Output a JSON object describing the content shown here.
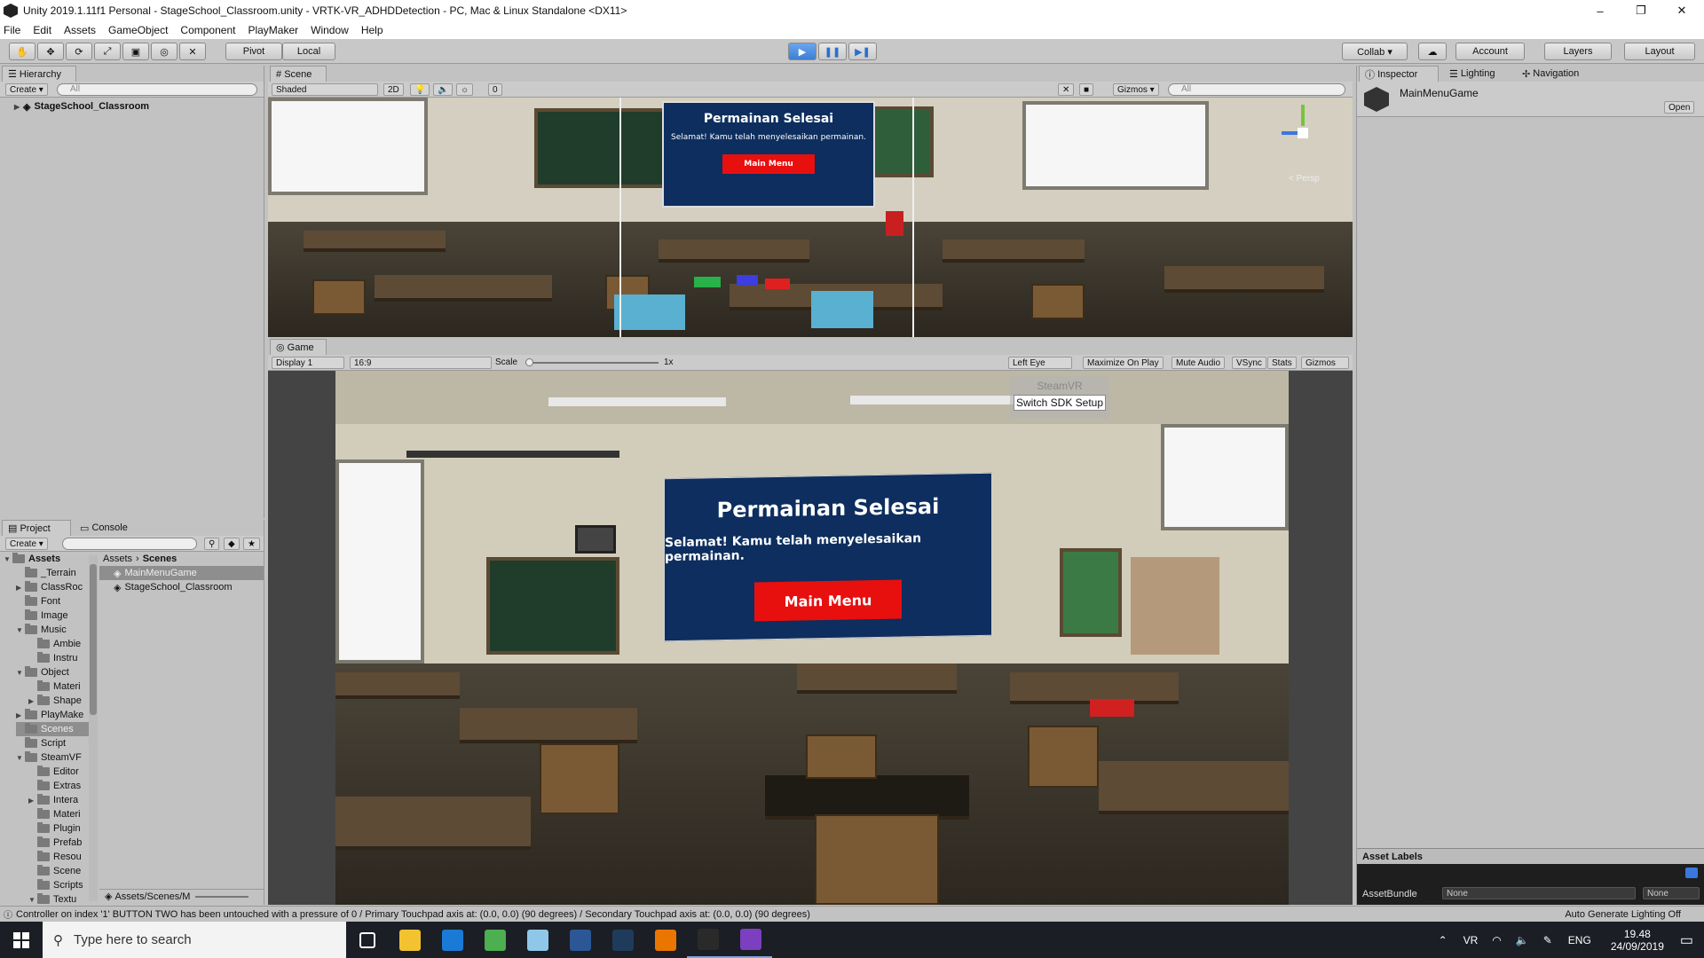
{
  "window": {
    "title": "Unity 2019.1.11f1 Personal - StageSchool_Classroom.unity - VRTK-VR_ADHDDetection - PC, Mac & Linux Standalone <DX11>",
    "minimize": "–",
    "maximize": "❐",
    "close": "✕"
  },
  "menu": [
    "File",
    "Edit",
    "Assets",
    "GameObject",
    "Component",
    "PlayMaker",
    "Window",
    "Help"
  ],
  "toolbar": {
    "pivot": "Pivot",
    "local": "Local",
    "collab": "Collab ▾",
    "account": "Account",
    "layers": "Layers",
    "layout": "Layout"
  },
  "hierarchy": {
    "tab": "Hierarchy",
    "create": "Create ▾",
    "search_placeholder": "All",
    "root": "StageSchool_Classroom"
  },
  "scene": {
    "tab": "Scene",
    "shading": "Shaded",
    "mode2d": "2D",
    "gizmos": "Gizmos ▾",
    "search_placeholder": "All",
    "fx_count": "0",
    "persp": "< Persp"
  },
  "game": {
    "tab": "Game",
    "display": "Display 1",
    "aspect": "16:9",
    "scale_label": "Scale",
    "scale_value": "1x",
    "left_eye": "Left Eye",
    "maximize": "Maximize On Play",
    "mute": "Mute Audio",
    "vsync": "VSync",
    "stats": "Stats",
    "gizmos": "Gizmos"
  },
  "overlay": {
    "steamvr": "SteamVR",
    "switch_sdk": "Switch SDK Setup"
  },
  "endcard": {
    "title": "Permainan Selesai",
    "message": "Selamat! Kamu telah menyelesaikan permainan.",
    "button": "Main Menu"
  },
  "inspector": {
    "tab": "Inspector",
    "tab_lighting": "Lighting",
    "tab_navigation": "Navigation",
    "object": "MainMenuGame",
    "open": "Open",
    "asset_labels": "Asset Labels",
    "assetbundle_label": "AssetBundle",
    "assetbundle_value": "None",
    "assetbundle_variant": "None"
  },
  "project": {
    "tab": "Project",
    "tab_console": "Console",
    "create": "Create ▾",
    "path_root": "Assets",
    "path_current": "Scenes",
    "tree": [
      {
        "label": "Assets",
        "indent": 0,
        "arrow": "▼"
      },
      {
        "label": "_Terrain",
        "indent": 1,
        "arrow": ""
      },
      {
        "label": "ClassRoc",
        "indent": 1,
        "arrow": "▶"
      },
      {
        "label": "Font",
        "indent": 1,
        "arrow": ""
      },
      {
        "label": "Image",
        "indent": 1,
        "arrow": ""
      },
      {
        "label": "Music",
        "indent": 1,
        "arrow": "▼"
      },
      {
        "label": "Ambie",
        "indent": 2,
        "arrow": ""
      },
      {
        "label": "Instru",
        "indent": 2,
        "arrow": ""
      },
      {
        "label": "Object",
        "indent": 1,
        "arrow": "▼"
      },
      {
        "label": "Materi",
        "indent": 2,
        "arrow": ""
      },
      {
        "label": "Shape",
        "indent": 2,
        "arrow": "▶"
      },
      {
        "label": "PlayMake",
        "indent": 1,
        "arrow": "▶"
      },
      {
        "label": "Scenes",
        "indent": 1,
        "arrow": ""
      },
      {
        "label": "Script",
        "indent": 1,
        "arrow": ""
      },
      {
        "label": "SteamVF",
        "indent": 1,
        "arrow": "▼"
      },
      {
        "label": "Editor",
        "indent": 2,
        "arrow": ""
      },
      {
        "label": "Extras",
        "indent": 2,
        "arrow": ""
      },
      {
        "label": "Intera",
        "indent": 2,
        "arrow": "▶"
      },
      {
        "label": "Materi",
        "indent": 2,
        "arrow": ""
      },
      {
        "label": "Plugin",
        "indent": 2,
        "arrow": ""
      },
      {
        "label": "Prefab",
        "indent": 2,
        "arrow": ""
      },
      {
        "label": "Resou",
        "indent": 2,
        "arrow": ""
      },
      {
        "label": "Scene",
        "indent": 2,
        "arrow": ""
      },
      {
        "label": "Scripts",
        "indent": 2,
        "arrow": ""
      },
      {
        "label": "Textu",
        "indent": 2,
        "arrow": "▼"
      }
    ],
    "files": [
      "MainMenuGame",
      "StageSchool_Classroom"
    ],
    "bottom_path": "Assets/Scenes/M"
  },
  "status": {
    "message": "Controller on index '1' BUTTON TWO has been untouched with a pressure of 0 / Primary Touchpad axis at: (0.0, 0.0) (90 degrees) / Secondary Touchpad axis at: (0.0, 0.0) (90 degrees)",
    "lighting": "Auto Generate Lighting Off"
  },
  "taskbar": {
    "search_placeholder": "Type here to search",
    "lang": "ENG",
    "time": "19.48",
    "date": "24/09/2019",
    "apps": [
      {
        "name": "task-view-icon",
        "color": "#1b1e24"
      },
      {
        "name": "file-explorer-icon",
        "color": "#f2c230"
      },
      {
        "name": "edge-icon",
        "color": "#1a7bd6"
      },
      {
        "name": "chrome-icon",
        "color": "#4caf50"
      },
      {
        "name": "unknown-app-icon",
        "color": "#8fc7e8"
      },
      {
        "name": "word-icon",
        "color": "#2b5797"
      },
      {
        "name": "steam-icon",
        "color": "#1f3b5c"
      },
      {
        "name": "blender-icon",
        "color": "#ea7600"
      },
      {
        "name": "unity-icon",
        "color": "#2a2a2a"
      },
      {
        "name": "visual-studio-icon",
        "color": "#7b3fbf"
      }
    ]
  }
}
